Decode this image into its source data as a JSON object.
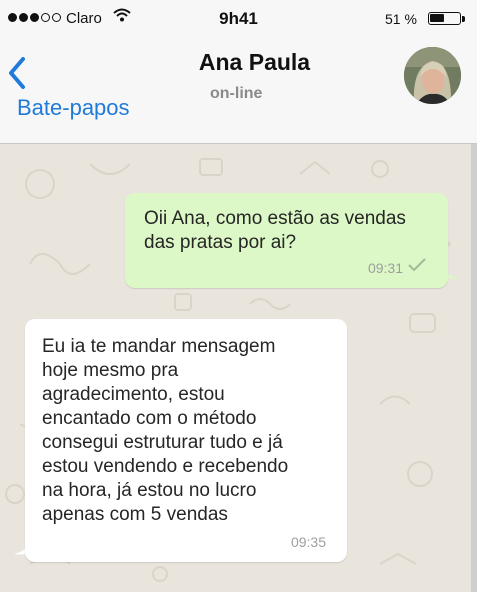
{
  "status_bar": {
    "carrier": "Claro",
    "time": "9h41",
    "battery_text": "51 %",
    "battery_level": 0.51,
    "signal_bars_filled": 3,
    "signal_bars_total": 5
  },
  "header": {
    "back_label": "Bate-papos",
    "contact_name": "Ana Paula",
    "contact_status": "on-line"
  },
  "messages": [
    {
      "direction": "outgoing",
      "text": "Oii Ana, como estão as vendas\ndas pratas por ai?",
      "time": "09:31",
      "status_icon": "check-icon"
    },
    {
      "direction": "incoming",
      "text": "Eu ia te mandar mensagem\nhoje mesmo pra\nagradecimento, estou\nencantado com o método\nconsegui estruturar tudo e já\nestou vendendo e recebendo\nna hora, já estou no lucro\napenas com 5 vendas",
      "time": "09:35"
    }
  ],
  "colors": {
    "accent": "#1f7ad9",
    "outgoing_bubble": "#dcf8c6",
    "incoming_bubble": "#ffffff",
    "chat_background": "#e9e5dd"
  }
}
